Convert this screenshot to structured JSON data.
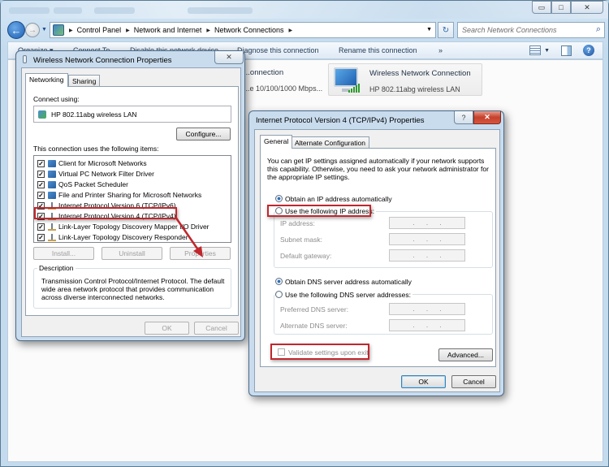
{
  "explorer": {
    "window_controls": {
      "minimize": "▭",
      "maximize": "□",
      "close": "✕"
    },
    "breadcrumb": [
      "Control Panel",
      "Network and Internet",
      "Network Connections"
    ],
    "search_placeholder": "Search Network Connections",
    "commands": [
      "Organize ▾",
      "Connect To",
      "Disable this network device",
      "Diagnose this connection",
      "Rename this connection",
      "»"
    ],
    "connections": [
      {
        "title": "...onnection",
        "subtitle": "...e 10/100/1000 Mbps..."
      },
      {
        "title": "Wireless Network Connection",
        "subtitle": "HP 802.11abg wireless LAN"
      }
    ]
  },
  "wlan_dialog": {
    "title": "Wireless Network Connection Properties",
    "close": "✕",
    "tabs": [
      "Networking",
      "Sharing"
    ],
    "connect_using_label": "Connect using:",
    "adapter": "HP 802.11abg wireless LAN",
    "configure_button": "Configure...",
    "items_label": "This connection uses the following items:",
    "items": [
      {
        "label": "Client for Microsoft Networks",
        "checked": true,
        "icon": "network-client-icon"
      },
      {
        "label": "Virtual PC Network Filter Driver",
        "checked": true,
        "icon": "network-service-icon"
      },
      {
        "label": "QoS Packet Scheduler",
        "checked": true,
        "icon": "network-service-icon"
      },
      {
        "label": "File and Printer Sharing for Microsoft Networks",
        "checked": true,
        "icon": "network-service-icon"
      },
      {
        "label": "Internet Protocol Version 6 (TCP/IPv6)",
        "checked": true,
        "icon": "protocol-icon"
      },
      {
        "label": "Internet Protocol Version 4 (TCP/IPv4)",
        "checked": true,
        "icon": "protocol-icon",
        "highlighted": true
      },
      {
        "label": "Link-Layer Topology Discovery Mapper I/O Driver",
        "checked": true,
        "icon": "protocol-icon"
      },
      {
        "label": "Link-Layer Topology Discovery Responder",
        "checked": true,
        "icon": "protocol-icon"
      }
    ],
    "install_button": "Install...",
    "uninstall_button": "Uninstall",
    "properties_button": "Properties",
    "description_legend": "Description",
    "description_text": "Transmission Control Protocol/Internet Protocol. The default wide area network protocol that provides communication across diverse interconnected networks.",
    "ok_button": "OK",
    "cancel_button": "Cancel"
  },
  "ipv4_dialog": {
    "title": "Internet Protocol Version 4 (TCP/IPv4) Properties",
    "help": "?",
    "close": "✕",
    "tabs": [
      "General",
      "Alternate Configuration"
    ],
    "intro": "You can get IP settings assigned automatically if your network supports this capability. Otherwise, you need to ask your network administrator for the appropriate IP settings.",
    "obtain_ip_auto": "Obtain an IP address automatically",
    "use_following_ip": "Use the following IP address:",
    "ip_address_label": "IP address:",
    "subnet_mask_label": "Subnet mask:",
    "default_gateway_label": "Default gateway:",
    "obtain_dns_auto": "Obtain DNS server address automatically",
    "use_following_dns": "Use the following DNS server addresses:",
    "preferred_dns_label": "Preferred DNS server:",
    "alternate_dns_label": "Alternate DNS server:",
    "validate_label": "Validate settings upon exit",
    "advanced_button": "Advanced...",
    "ok_button": "OK",
    "cancel_button": "Cancel",
    "ip_mode": "automatic",
    "dns_mode": "automatic",
    "validate_checked": false
  },
  "annotation_color": "#c0272d"
}
